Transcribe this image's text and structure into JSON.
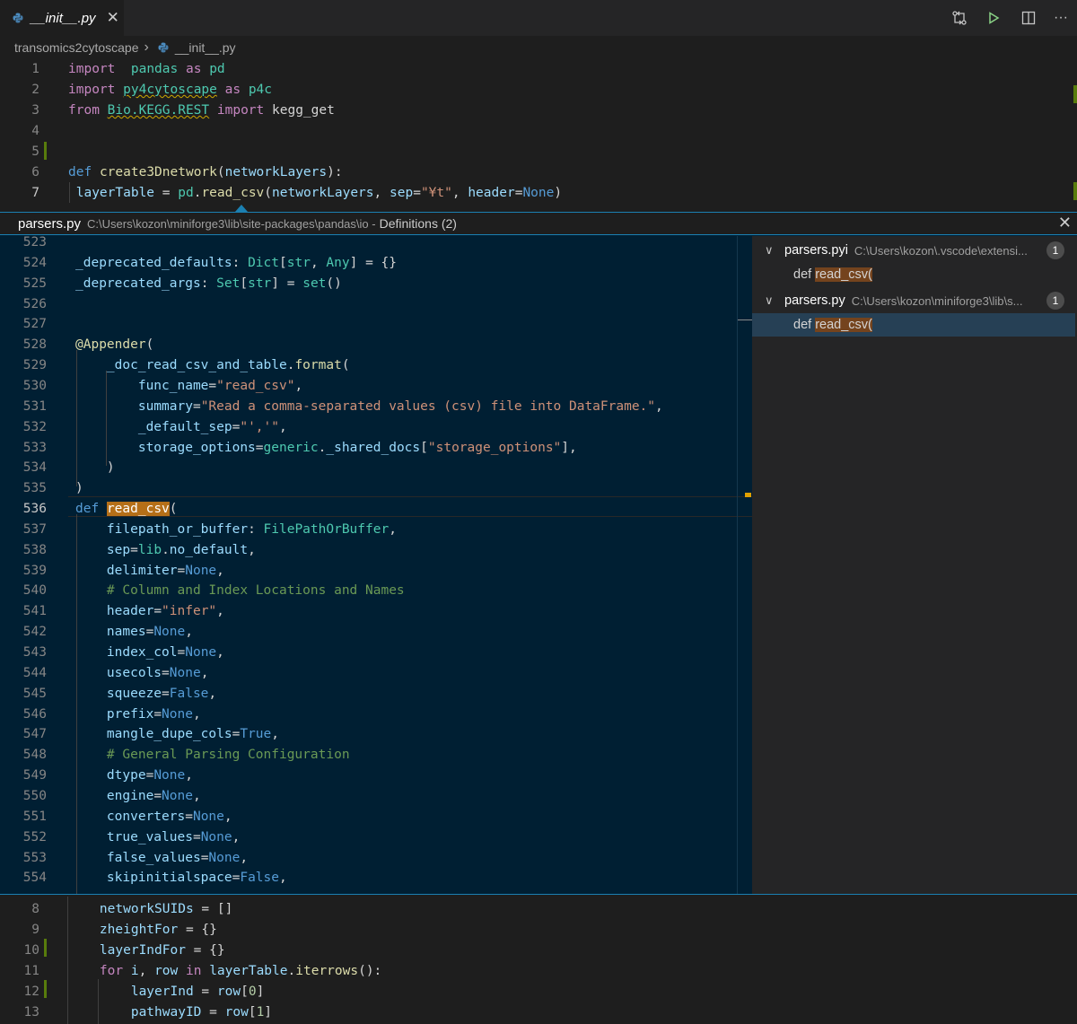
{
  "tab": {
    "filename": "__init__.py",
    "close": "✕"
  },
  "toolbar": {
    "icons": [
      "source-control-icon",
      "run-icon",
      "split-editor-icon",
      "more-icon"
    ],
    "more": "···"
  },
  "breadcrumb": {
    "folder": "transomics2cytoscape",
    "sep": "›",
    "file": "__init__.py"
  },
  "editor_top": {
    "lines": [
      {
        "n": "1",
        "code": [
          [
            "kw2",
            "import"
          ],
          [
            "",
            "  "
          ],
          [
            "cls",
            "pandas"
          ],
          [
            "",
            " "
          ],
          [
            "kw2",
            "as"
          ],
          [
            "",
            " "
          ],
          [
            "cls",
            "pd"
          ]
        ]
      },
      {
        "n": "2",
        "code": [
          [
            "kw2",
            "import"
          ],
          [
            "",
            " "
          ],
          [
            "cls wavy",
            "py4cytoscape"
          ],
          [
            "",
            " "
          ],
          [
            "kw2",
            "as"
          ],
          [
            "",
            " "
          ],
          [
            "cls",
            "p4c"
          ]
        ]
      },
      {
        "n": "3",
        "code": [
          [
            "kw2",
            "from"
          ],
          [
            "",
            " "
          ],
          [
            "cls wavy",
            "Bio.KEGG.REST"
          ],
          [
            "",
            " "
          ],
          [
            "kw2",
            "import"
          ],
          [
            "",
            " kegg_get"
          ]
        ]
      },
      {
        "n": "4",
        "code": []
      },
      {
        "n": "5",
        "code": []
      },
      {
        "n": "6",
        "code": [
          [
            "kw",
            "def"
          ],
          [
            "",
            " "
          ],
          [
            "fn",
            "create3Dnetwork"
          ],
          [
            "",
            "("
          ],
          [
            "var",
            "networkLayers"
          ],
          [
            "",
            "):"
          ]
        ]
      },
      {
        "n": "7",
        "code": [
          [
            "",
            " "
          ],
          [
            "var",
            "layerTable"
          ],
          [
            "",
            " = "
          ],
          [
            "cls",
            "pd"
          ],
          [
            "",
            "."
          ],
          [
            "fn",
            "read_csv"
          ],
          [
            "",
            "("
          ],
          [
            "var",
            "networkLayers"
          ],
          [
            "",
            ", "
          ],
          [
            "var",
            "sep"
          ],
          [
            "",
            "="
          ],
          [
            "str",
            "\"¥t\""
          ],
          [
            "",
            ", "
          ],
          [
            "var",
            "header"
          ],
          [
            "",
            "="
          ],
          [
            "kw",
            "None"
          ],
          [
            "",
            ")"
          ]
        ]
      }
    ]
  },
  "peek": {
    "file": "parsers.py",
    "path": "C:\\Users\\kozon\\miniforge3\\lib\\site-packages\\pandas\\io -",
    "title": "Definitions (2)",
    "close": "✕",
    "lines": [
      {
        "n": "523",
        "code": []
      },
      {
        "n": "524",
        "code": [
          [
            "var",
            "_deprecated_defaults"
          ],
          [
            "",
            ": "
          ],
          [
            "cls",
            "Dict"
          ],
          [
            "",
            "["
          ],
          [
            "cls",
            "str"
          ],
          [
            "",
            ", "
          ],
          [
            "cls",
            "Any"
          ],
          [
            "",
            "] = {}"
          ]
        ]
      },
      {
        "n": "525",
        "code": [
          [
            "var",
            "_deprecated_args"
          ],
          [
            "",
            ": "
          ],
          [
            "cls",
            "Set"
          ],
          [
            "",
            "["
          ],
          [
            "cls",
            "str"
          ],
          [
            "",
            "] = "
          ],
          [
            "cls",
            "set"
          ],
          [
            "",
            "()"
          ]
        ]
      },
      {
        "n": "526",
        "code": []
      },
      {
        "n": "527",
        "code": []
      },
      {
        "n": "528",
        "code": [
          [
            "fn",
            "@Appender"
          ],
          [
            "",
            "("
          ]
        ]
      },
      {
        "n": "529",
        "code": [
          [
            "",
            "    "
          ],
          [
            "var",
            "_doc_read_csv_and_table"
          ],
          [
            "",
            "."
          ],
          [
            "fn",
            "format"
          ],
          [
            "",
            "("
          ]
        ]
      },
      {
        "n": "530",
        "code": [
          [
            "",
            "        "
          ],
          [
            "var",
            "func_name"
          ],
          [
            "",
            "="
          ],
          [
            "str",
            "\"read_csv\""
          ],
          [
            "",
            ","
          ]
        ]
      },
      {
        "n": "531",
        "code": [
          [
            "",
            "        "
          ],
          [
            "var",
            "summary"
          ],
          [
            "",
            "="
          ],
          [
            "str",
            "\"Read a comma-separated values (csv) file into DataFrame.\""
          ],
          [
            "",
            ","
          ]
        ]
      },
      {
        "n": "532",
        "code": [
          [
            "",
            "        "
          ],
          [
            "var",
            "_default_sep"
          ],
          [
            "",
            "="
          ],
          [
            "str",
            "\"','\""
          ],
          [
            "",
            ","
          ]
        ]
      },
      {
        "n": "533",
        "code": [
          [
            "",
            "        "
          ],
          [
            "var",
            "storage_options"
          ],
          [
            "",
            "="
          ],
          [
            "cls",
            "generic"
          ],
          [
            "",
            "."
          ],
          [
            "var",
            "_shared_docs"
          ],
          [
            "",
            "["
          ],
          [
            "str",
            "\"storage_options\""
          ],
          [
            "",
            "],"
          ]
        ]
      },
      {
        "n": "534",
        "code": [
          [
            "",
            "    )"
          ]
        ]
      },
      {
        "n": "535",
        "code": [
          [
            "",
            ")"
          ]
        ]
      },
      {
        "n": "536",
        "code": [
          [
            "kw",
            "def"
          ],
          [
            "",
            " "
          ],
          [
            "fn hl",
            "read_csv"
          ],
          [
            "",
            "("
          ]
        ]
      },
      {
        "n": "537",
        "code": [
          [
            "",
            "    "
          ],
          [
            "var",
            "filepath_or_buffer"
          ],
          [
            "",
            ": "
          ],
          [
            "cls",
            "FilePathOrBuffer"
          ],
          [
            "",
            ","
          ]
        ]
      },
      {
        "n": "538",
        "code": [
          [
            "",
            "    "
          ],
          [
            "var",
            "sep"
          ],
          [
            "",
            "="
          ],
          [
            "cls",
            "lib"
          ],
          [
            "",
            "."
          ],
          [
            "var",
            "no_default"
          ],
          [
            "",
            ","
          ]
        ]
      },
      {
        "n": "539",
        "code": [
          [
            "",
            "    "
          ],
          [
            "var",
            "delimiter"
          ],
          [
            "",
            "="
          ],
          [
            "kw",
            "None"
          ],
          [
            "",
            ","
          ]
        ]
      },
      {
        "n": "540",
        "code": [
          [
            "",
            "    "
          ],
          [
            "cm",
            "# Column and Index Locations and Names"
          ]
        ]
      },
      {
        "n": "541",
        "code": [
          [
            "",
            "    "
          ],
          [
            "var",
            "header"
          ],
          [
            "",
            "="
          ],
          [
            "str",
            "\"infer\""
          ],
          [
            "",
            ","
          ]
        ]
      },
      {
        "n": "542",
        "code": [
          [
            "",
            "    "
          ],
          [
            "var",
            "names"
          ],
          [
            "",
            "="
          ],
          [
            "kw",
            "None"
          ],
          [
            "",
            ","
          ]
        ]
      },
      {
        "n": "543",
        "code": [
          [
            "",
            "    "
          ],
          [
            "var",
            "index_col"
          ],
          [
            "",
            "="
          ],
          [
            "kw",
            "None"
          ],
          [
            "",
            ","
          ]
        ]
      },
      {
        "n": "544",
        "code": [
          [
            "",
            "    "
          ],
          [
            "var",
            "usecols"
          ],
          [
            "",
            "="
          ],
          [
            "kw",
            "None"
          ],
          [
            "",
            ","
          ]
        ]
      },
      {
        "n": "545",
        "code": [
          [
            "",
            "    "
          ],
          [
            "var",
            "squeeze"
          ],
          [
            "",
            "="
          ],
          [
            "kw",
            "False"
          ],
          [
            "",
            ","
          ]
        ]
      },
      {
        "n": "546",
        "code": [
          [
            "",
            "    "
          ],
          [
            "var",
            "prefix"
          ],
          [
            "",
            "="
          ],
          [
            "kw",
            "None"
          ],
          [
            "",
            ","
          ]
        ]
      },
      {
        "n": "547",
        "code": [
          [
            "",
            "    "
          ],
          [
            "var",
            "mangle_dupe_cols"
          ],
          [
            "",
            "="
          ],
          [
            "kw",
            "True"
          ],
          [
            "",
            ","
          ]
        ]
      },
      {
        "n": "548",
        "code": [
          [
            "",
            "    "
          ],
          [
            "cm",
            "# General Parsing Configuration"
          ]
        ]
      },
      {
        "n": "549",
        "code": [
          [
            "",
            "    "
          ],
          [
            "var",
            "dtype"
          ],
          [
            "",
            "="
          ],
          [
            "kw",
            "None"
          ],
          [
            "",
            ","
          ]
        ]
      },
      {
        "n": "550",
        "code": [
          [
            "",
            "    "
          ],
          [
            "var",
            "engine"
          ],
          [
            "",
            "="
          ],
          [
            "kw",
            "None"
          ],
          [
            "",
            ","
          ]
        ]
      },
      {
        "n": "551",
        "code": [
          [
            "",
            "    "
          ],
          [
            "var",
            "converters"
          ],
          [
            "",
            "="
          ],
          [
            "kw",
            "None"
          ],
          [
            "",
            ","
          ]
        ]
      },
      {
        "n": "552",
        "code": [
          [
            "",
            "    "
          ],
          [
            "var",
            "true_values"
          ],
          [
            "",
            "="
          ],
          [
            "kw",
            "None"
          ],
          [
            "",
            ","
          ]
        ]
      },
      {
        "n": "553",
        "code": [
          [
            "",
            "    "
          ],
          [
            "var",
            "false_values"
          ],
          [
            "",
            "="
          ],
          [
            "kw",
            "None"
          ],
          [
            "",
            ","
          ]
        ]
      },
      {
        "n": "554",
        "code": [
          [
            "",
            "    "
          ],
          [
            "var",
            "skipinitialspace"
          ],
          [
            "",
            "="
          ],
          [
            "kw",
            "False"
          ],
          [
            "",
            ","
          ]
        ]
      }
    ],
    "refs": [
      {
        "file": "parsers.pyi",
        "path": "C:\\Users\\kozon\\.vscode\\extensi...",
        "count": "1",
        "item": "read_csv(",
        "def": "def "
      },
      {
        "file": "parsers.py",
        "path": "C:\\Users\\kozon\\miniforge3\\lib\\s...",
        "count": "1",
        "item": "read_csv(",
        "def": "def "
      }
    ]
  },
  "editor_bottom": {
    "lines": [
      {
        "n": "8",
        "code": [
          [
            "",
            "    "
          ],
          [
            "var",
            "networkSUIDs"
          ],
          [
            "",
            " = []"
          ]
        ]
      },
      {
        "n": "9",
        "code": [
          [
            "",
            "    "
          ],
          [
            "var",
            "zheightFor"
          ],
          [
            "",
            " = {}"
          ]
        ]
      },
      {
        "n": "10",
        "code": [
          [
            "",
            "    "
          ],
          [
            "var",
            "layerIndFor"
          ],
          [
            "",
            " = {}"
          ]
        ]
      },
      {
        "n": "11",
        "code": [
          [
            "",
            "    "
          ],
          [
            "kw2",
            "for"
          ],
          [
            "",
            " "
          ],
          [
            "var",
            "i"
          ],
          [
            "",
            ", "
          ],
          [
            "var",
            "row"
          ],
          [
            "",
            " "
          ],
          [
            "kw2",
            "in"
          ],
          [
            "",
            " "
          ],
          [
            "var",
            "layerTable"
          ],
          [
            "",
            "."
          ],
          [
            "fn",
            "iterrows"
          ],
          [
            "",
            "():"
          ]
        ]
      },
      {
        "n": "12",
        "code": [
          [
            "",
            "        "
          ],
          [
            "var",
            "layerInd"
          ],
          [
            "",
            " = "
          ],
          [
            "var",
            "row"
          ],
          [
            "",
            "["
          ],
          [
            "num",
            "0"
          ],
          [
            "",
            "]"
          ]
        ]
      },
      {
        "n": "13",
        "code": [
          [
            "",
            "        "
          ],
          [
            "var",
            "pathwayID"
          ],
          [
            "",
            " = "
          ],
          [
            "var",
            "row"
          ],
          [
            "",
            "["
          ],
          [
            "num",
            "1"
          ],
          [
            "",
            "]"
          ]
        ]
      }
    ]
  }
}
